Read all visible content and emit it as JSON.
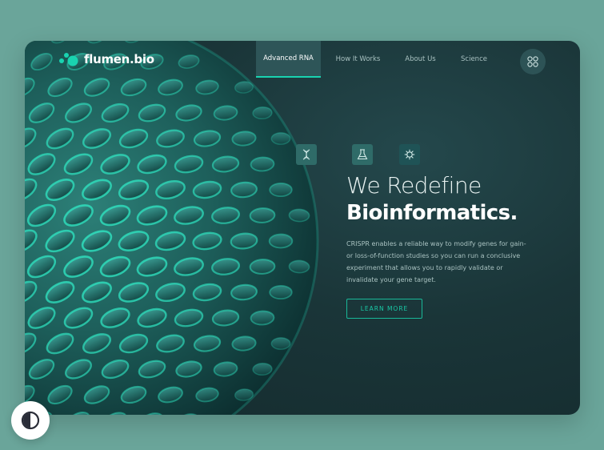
{
  "brand": {
    "name": "flumen.bio"
  },
  "nav": {
    "items": [
      {
        "label": "Advanced RNA",
        "active": true
      },
      {
        "label": "How It Works",
        "active": false
      },
      {
        "label": "About Us",
        "active": false
      },
      {
        "label": "Science",
        "active": false
      }
    ],
    "menu_icon": "grid-circles-icon"
  },
  "features": [
    {
      "icon": "dna-icon"
    },
    {
      "icon": "flask-icon"
    },
    {
      "icon": "virus-icon"
    }
  ],
  "hero": {
    "title_light": "We Redefine",
    "title_bold": "Bioinformatics.",
    "description": "CRISPR enables a reliable way to modify genes for gain-or loss-of-function studies so you can run a conclusive experiment that allows you to rapidly validate or invalidate your gene target.",
    "cta_label": "LEARN MORE"
  },
  "theme_toggle": {
    "icon": "contrast-icon"
  },
  "colors": {
    "accent": "#19d3b0",
    "page_bg": "#6aa59a",
    "card_bg": "#1a3538",
    "text_muted": "#a9c2c1"
  }
}
